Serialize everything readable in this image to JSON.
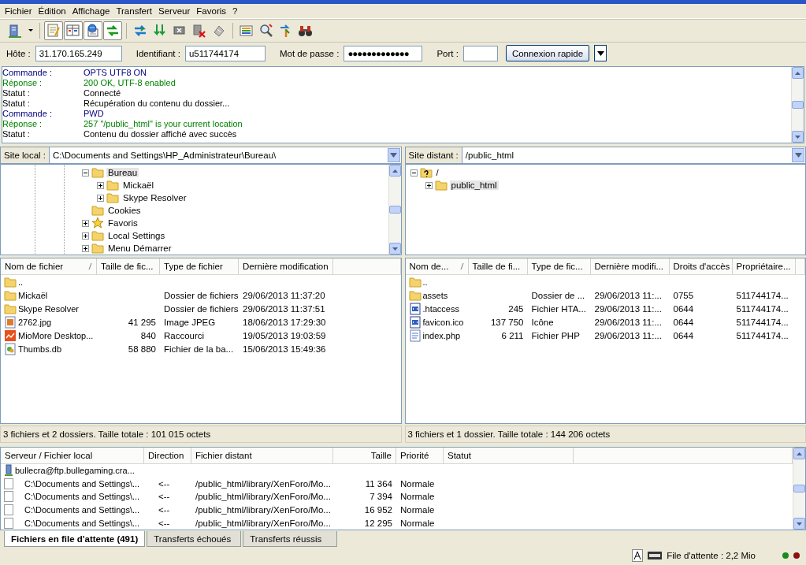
{
  "menu": [
    "Fichier",
    "Édition",
    "Affichage",
    "Transfert",
    "Serveur",
    "Favoris",
    "?"
  ],
  "toolbar": [
    {
      "kind": "server",
      "on": false
    },
    {
      "kind": "dropdown",
      "on": false
    },
    {
      "kind": "notepad",
      "on": true
    },
    {
      "kind": "panels",
      "on": true
    },
    {
      "kind": "globe",
      "on": true
    },
    {
      "kind": "swap",
      "on": true
    },
    {
      "kind": "refresh",
      "on": false
    },
    {
      "kind": "download",
      "on": false
    },
    {
      "kind": "cancel",
      "on": false
    },
    {
      "kind": "disconnect",
      "on": false
    },
    {
      "kind": "reconnect",
      "on": false
    },
    {
      "kind": "compare",
      "on": false
    },
    {
      "kind": "filter",
      "on": false
    },
    {
      "kind": "sync",
      "on": false
    },
    {
      "kind": "binoculars",
      "on": false
    }
  ],
  "quickconnect": {
    "fields": [
      {
        "kind": "text",
        "label": "Hôte :",
        "value": "31.170.165.249"
      },
      {
        "kind": "text",
        "label": "Identifiant :",
        "value": "u511744174"
      },
      {
        "kind": "password",
        "label": "Mot de passe :",
        "value": "●●●●●●●●●●●●●"
      },
      {
        "kind": "text",
        "label": "Port :"
      }
    ],
    "button": "Connexion rapide"
  },
  "log": [
    {
      "kind": "command",
      "label": "Commande :",
      "text": "OPTS UTF8 ON"
    },
    {
      "kind": "response",
      "label": "Réponse :",
      "text": "200 OK, UTF-8 enabled"
    },
    {
      "kind": "status",
      "label": "Statut :",
      "text": "Connecté"
    },
    {
      "kind": "status",
      "label": "Statut :",
      "text": "Récupération du contenu du dossier..."
    },
    {
      "kind": "command",
      "label": "Commande :",
      "text": "PWD"
    },
    {
      "kind": "response",
      "label": "Réponse :",
      "text": "257 \"/public_html\" is your current location"
    },
    {
      "kind": "status",
      "label": "Statut :",
      "text": "Contenu du dossier affiché avec succès"
    }
  ],
  "local": {
    "label": "Site local :",
    "path": "C:\\Documents and Settings\\HP_Administrateur\\Bureau\\",
    "tree": [
      {
        "name": "Bureau",
        "kind": "folder",
        "expanded": true,
        "selected": true,
        "children": [
          {
            "name": "Mickaël",
            "kind": "folder",
            "expanded": false,
            "selected": false
          },
          {
            "name": "Skype Resolver",
            "kind": "folder",
            "expanded": false,
            "selected": false
          }
        ]
      },
      {
        "name": "Cookies",
        "kind": "folder",
        "selected": false
      },
      {
        "name": "Favoris",
        "kind": "star",
        "expanded": false,
        "selected": false
      },
      {
        "name": "Local Settings",
        "kind": "folder",
        "expanded": false,
        "selected": false
      },
      {
        "name": "Menu Démarrer",
        "kind": "folder",
        "expanded": false,
        "selected": false
      }
    ],
    "columns": [
      "Nom de fichier",
      "Taille de fic...",
      "Type de fichier",
      "Dernière modification"
    ],
    "rows": [
      {
        "kind": "folder",
        "name": ".."
      },
      {
        "kind": "folder",
        "name": "Mickaël",
        "type": "Dossier de fichiers",
        "modified": "29/06/2013 11:37:20"
      },
      {
        "kind": "folder",
        "name": "Skype Resolver",
        "type": "Dossier de fichiers",
        "modified": "29/06/2013 11:37:51"
      },
      {
        "kind": "image",
        "name": "2762.jpg",
        "size": "41 295",
        "type": "Image JPEG",
        "modified": "18/06/2013 17:29:30"
      },
      {
        "kind": "shortcut",
        "name": "MioMore Desktop...",
        "size": "840",
        "type": "Raccourci",
        "modified": "19/05/2013 19:03:59"
      },
      {
        "kind": "db",
        "name": "Thumbs.db",
        "size": "58 880",
        "type": "Fichier de la ba...",
        "modified": "15/06/2013 15:49:36"
      }
    ],
    "status": "3 fichiers et 2 dossiers. Taille totale : 101 015 octets"
  },
  "remote": {
    "label": "Site distant :",
    "path": "/public_html",
    "tree": [
      {
        "name": "/",
        "kind": "unknown",
        "expanded": true,
        "selected": false,
        "children": [
          {
            "name": "public_html",
            "kind": "folder",
            "expanded": false,
            "selected": true
          }
        ]
      }
    ],
    "columns": [
      "Nom de...",
      "Taille de fi...",
      "Type de fic...",
      "Dernière modifi...",
      "Droits d'accès",
      "Propriétaire..."
    ],
    "rows": [
      {
        "kind": "folder",
        "name": ".."
      },
      {
        "kind": "folder",
        "name": "assets",
        "type": "Dossier de ...",
        "modified": "29/06/2013 11:...",
        "permissions": "0755",
        "owner": "511744174..."
      },
      {
        "kind": "web",
        "name": ".htaccess",
        "size": "245",
        "type": "Fichier HTA...",
        "modified": "29/06/2013 11:...",
        "permissions": "0644",
        "owner": "511744174..."
      },
      {
        "kind": "web",
        "name": "favicon.ico",
        "size": "137 750",
        "type": "Icône",
        "modified": "29/06/2013 11:...",
        "permissions": "0644",
        "owner": "511744174..."
      },
      {
        "kind": "page",
        "name": "index.php",
        "size": "6 211",
        "type": "Fichier PHP",
        "modified": "29/06/2013 11:...",
        "permissions": "0644",
        "owner": "511744174..."
      }
    ],
    "status": "3 fichiers et 1 dossier. Taille totale : 144 206 octets"
  },
  "queue": {
    "columns": [
      "Serveur / Fichier local",
      "Direction",
      "Fichier distant",
      "Taille",
      "Priorité",
      "Statut"
    ],
    "rows": [
      {
        "kind": "server",
        "local": "bullecra@ftp.bullegaming.cra..."
      },
      {
        "kind": "file",
        "checked": false,
        "local": "C:\\Documents and Settings\\...",
        "direction": "<--",
        "remote": "/public_html/library/XenForo/Mo...",
        "size": "11 364",
        "priority": "Normale"
      },
      {
        "kind": "file",
        "checked": false,
        "local": "C:\\Documents and Settings\\...",
        "direction": "<--",
        "remote": "/public_html/library/XenForo/Mo...",
        "size": "7 394",
        "priority": "Normale"
      },
      {
        "kind": "file",
        "checked": false,
        "local": "C:\\Documents and Settings\\...",
        "direction": "<--",
        "remote": "/public_html/library/XenForo/Mo...",
        "size": "16 952",
        "priority": "Normale"
      },
      {
        "kind": "file",
        "checked": false,
        "local": "C:\\Documents and Settings\\...",
        "direction": "<--",
        "remote": "/public_html/library/XenForo/Mo...",
        "size": "12 295",
        "priority": "Normale"
      }
    ]
  },
  "tabs": [
    {
      "label": "Fichiers en file d'attente (491)",
      "selected": true
    },
    {
      "label": "Transferts échoués",
      "selected": false
    },
    {
      "label": "Transferts réussis",
      "selected": false
    }
  ],
  "status_bar": {
    "queue": "File d'attente : 2,2 Mio",
    "lights": [
      {
        "color": "#1a8a1a"
      },
      {
        "color": "#8a1010"
      }
    ]
  }
}
